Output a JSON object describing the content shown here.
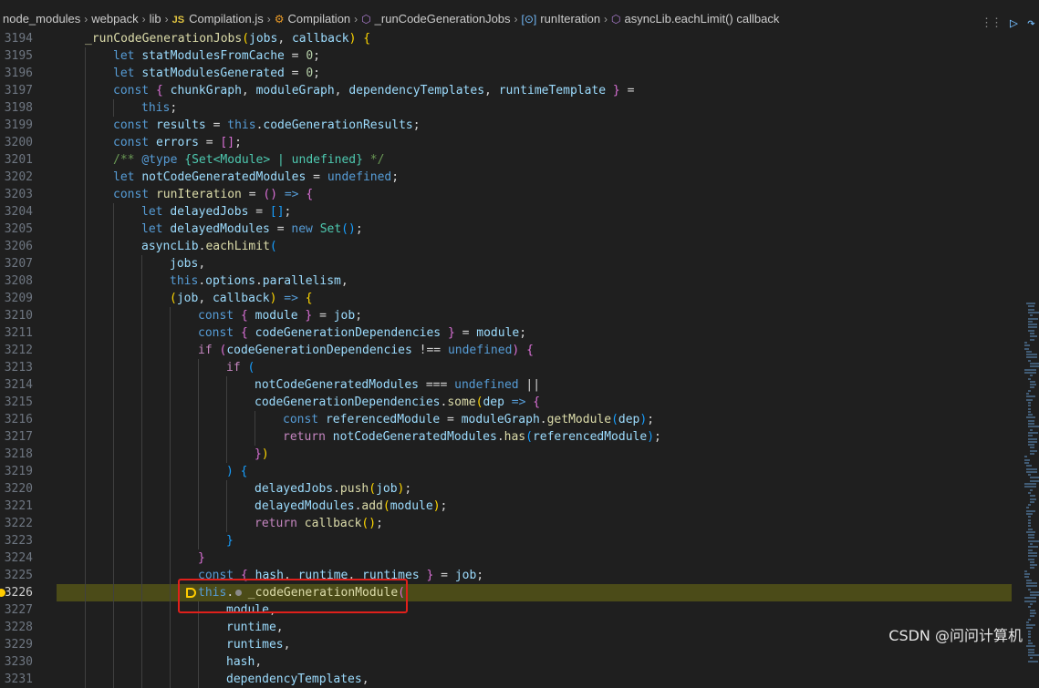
{
  "breadcrumb": {
    "items": [
      "node_modules",
      "webpack",
      "lib",
      "Compilation.js",
      "Compilation",
      "_runCodeGenerationJobs",
      "runIteration",
      "asyncLib.eachLimit() callback"
    ],
    "js_badge": "JS"
  },
  "editor": {
    "first_line": 3194,
    "current_line": 3226,
    "lines": [
      {
        "n": "3194",
        "indent": 1,
        "tokens": [
          [
            "f",
            "_runCodeGenerationJobs"
          ],
          [
            "b1",
            "("
          ],
          [
            "v",
            "jobs"
          ],
          [
            "p",
            ", "
          ],
          [
            "v",
            "callback"
          ],
          [
            "b1",
            ")"
          ],
          [
            "p",
            " "
          ],
          [
            "b1",
            "{"
          ]
        ]
      },
      {
        "n": "3195",
        "indent": 2,
        "tokens": [
          [
            "k",
            "let "
          ],
          [
            "v",
            "statModulesFromCache"
          ],
          [
            "p",
            " = "
          ],
          [
            "n",
            "0"
          ],
          [
            "p",
            ";"
          ]
        ]
      },
      {
        "n": "3196",
        "indent": 2,
        "tokens": [
          [
            "k",
            "let "
          ],
          [
            "v",
            "statModulesGenerated"
          ],
          [
            "p",
            " = "
          ],
          [
            "n",
            "0"
          ],
          [
            "p",
            ";"
          ]
        ]
      },
      {
        "n": "3197",
        "indent": 2,
        "tokens": [
          [
            "k",
            "const "
          ],
          [
            "b2",
            "{ "
          ],
          [
            "v",
            "chunkGraph"
          ],
          [
            "p",
            ", "
          ],
          [
            "v",
            "moduleGraph"
          ],
          [
            "p",
            ", "
          ],
          [
            "v",
            "dependencyTemplates"
          ],
          [
            "p",
            ", "
          ],
          [
            "v",
            "runtimeTemplate"
          ],
          [
            "b2",
            " }"
          ],
          [
            "p",
            " ="
          ]
        ]
      },
      {
        "n": "3198",
        "indent": 3,
        "tokens": [
          [
            "k",
            "this"
          ],
          [
            "p",
            ";"
          ]
        ]
      },
      {
        "n": "3199",
        "indent": 2,
        "tokens": [
          [
            "k",
            "const "
          ],
          [
            "v",
            "results"
          ],
          [
            "p",
            " = "
          ],
          [
            "k",
            "this"
          ],
          [
            "p",
            "."
          ],
          [
            "v",
            "codeGenerationResults"
          ],
          [
            "p",
            ";"
          ]
        ]
      },
      {
        "n": "3200",
        "indent": 2,
        "tokens": [
          [
            "k",
            "const "
          ],
          [
            "v",
            "errors"
          ],
          [
            "p",
            " = "
          ],
          [
            "b2",
            "[]"
          ],
          [
            "p",
            ";"
          ]
        ]
      },
      {
        "n": "3201",
        "indent": 2,
        "tokens": [
          [
            "c",
            "/** "
          ],
          [
            "k",
            "@type"
          ],
          [
            "c",
            " "
          ],
          [
            "t",
            "{Set<Module> | undefined}"
          ],
          [
            "c",
            " */"
          ]
        ]
      },
      {
        "n": "3202",
        "indent": 2,
        "tokens": [
          [
            "k",
            "let "
          ],
          [
            "v",
            "notCodeGeneratedModules"
          ],
          [
            "p",
            " = "
          ],
          [
            "k",
            "undefined"
          ],
          [
            "p",
            ";"
          ]
        ]
      },
      {
        "n": "3203",
        "indent": 2,
        "tokens": [
          [
            "k",
            "const "
          ],
          [
            "f",
            "runIteration"
          ],
          [
            "p",
            " = "
          ],
          [
            "b2",
            "()"
          ],
          [
            "p",
            " "
          ],
          [
            "k",
            "=>"
          ],
          [
            "p",
            " "
          ],
          [
            "b2",
            "{"
          ]
        ]
      },
      {
        "n": "3204",
        "indent": 3,
        "tokens": [
          [
            "k",
            "let "
          ],
          [
            "v",
            "delayedJobs"
          ],
          [
            "p",
            " = "
          ],
          [
            "b3",
            "[]"
          ],
          [
            "p",
            ";"
          ]
        ]
      },
      {
        "n": "3205",
        "indent": 3,
        "tokens": [
          [
            "k",
            "let "
          ],
          [
            "v",
            "delayedModules"
          ],
          [
            "p",
            " = "
          ],
          [
            "k",
            "new "
          ],
          [
            "t",
            "Set"
          ],
          [
            "b3",
            "()"
          ],
          [
            "p",
            ";"
          ]
        ]
      },
      {
        "n": "3206",
        "indent": 3,
        "tokens": [
          [
            "v",
            "asyncLib"
          ],
          [
            "p",
            "."
          ],
          [
            "f",
            "eachLimit"
          ],
          [
            "b3",
            "("
          ]
        ]
      },
      {
        "n": "3207",
        "indent": 4,
        "tokens": [
          [
            "v",
            "jobs"
          ],
          [
            "p",
            ","
          ]
        ]
      },
      {
        "n": "3208",
        "indent": 4,
        "tokens": [
          [
            "k",
            "this"
          ],
          [
            "p",
            "."
          ],
          [
            "v",
            "options"
          ],
          [
            "p",
            "."
          ],
          [
            "v",
            "parallelism"
          ],
          [
            "p",
            ","
          ]
        ]
      },
      {
        "n": "3209",
        "indent": 4,
        "tokens": [
          [
            "b1",
            "("
          ],
          [
            "v",
            "job"
          ],
          [
            "p",
            ", "
          ],
          [
            "v",
            "callback"
          ],
          [
            "b1",
            ")"
          ],
          [
            "p",
            " "
          ],
          [
            "k",
            "=>"
          ],
          [
            "p",
            " "
          ],
          [
            "b1",
            "{"
          ]
        ]
      },
      {
        "n": "3210",
        "indent": 5,
        "tokens": [
          [
            "k",
            "const "
          ],
          [
            "b2",
            "{ "
          ],
          [
            "v",
            "module"
          ],
          [
            "b2",
            " }"
          ],
          [
            "p",
            " = "
          ],
          [
            "v",
            "job"
          ],
          [
            "p",
            ";"
          ]
        ]
      },
      {
        "n": "3211",
        "indent": 5,
        "tokens": [
          [
            "k",
            "const "
          ],
          [
            "b2",
            "{ "
          ],
          [
            "v",
            "codeGenerationDependencies"
          ],
          [
            "b2",
            " }"
          ],
          [
            "p",
            " = "
          ],
          [
            "v",
            "module"
          ],
          [
            "p",
            ";"
          ]
        ]
      },
      {
        "n": "3212",
        "indent": 5,
        "tokens": [
          [
            "kc",
            "if "
          ],
          [
            "b2",
            "("
          ],
          [
            "v",
            "codeGenerationDependencies"
          ],
          [
            "p",
            " !== "
          ],
          [
            "k",
            "undefined"
          ],
          [
            "b2",
            ")"
          ],
          [
            "p",
            " "
          ],
          [
            "b2",
            "{"
          ]
        ]
      },
      {
        "n": "3213",
        "indent": 6,
        "tokens": [
          [
            "kc",
            "if "
          ],
          [
            "b3",
            "("
          ]
        ]
      },
      {
        "n": "3214",
        "indent": 7,
        "tokens": [
          [
            "v",
            "notCodeGeneratedModules"
          ],
          [
            "p",
            " === "
          ],
          [
            "k",
            "undefined"
          ],
          [
            "p",
            " ||"
          ]
        ]
      },
      {
        "n": "3215",
        "indent": 7,
        "tokens": [
          [
            "v",
            "codeGenerationDependencies"
          ],
          [
            "p",
            "."
          ],
          [
            "f",
            "some"
          ],
          [
            "b1",
            "("
          ],
          [
            "v",
            "dep"
          ],
          [
            "p",
            " "
          ],
          [
            "k",
            "=>"
          ],
          [
            "p",
            " "
          ],
          [
            "b2",
            "{"
          ]
        ]
      },
      {
        "n": "3216",
        "indent": 8,
        "tokens": [
          [
            "k",
            "const "
          ],
          [
            "v",
            "referencedModule"
          ],
          [
            "p",
            " = "
          ],
          [
            "v",
            "moduleGraph"
          ],
          [
            "p",
            "."
          ],
          [
            "f",
            "getModule"
          ],
          [
            "b3",
            "("
          ],
          [
            "v",
            "dep"
          ],
          [
            "b3",
            ")"
          ],
          [
            "p",
            ";"
          ]
        ]
      },
      {
        "n": "3217",
        "indent": 8,
        "tokens": [
          [
            "kc",
            "return "
          ],
          [
            "v",
            "notCodeGeneratedModules"
          ],
          [
            "p",
            "."
          ],
          [
            "f",
            "has"
          ],
          [
            "b3",
            "("
          ],
          [
            "v",
            "referencedModule"
          ],
          [
            "b3",
            ")"
          ],
          [
            "p",
            ";"
          ]
        ]
      },
      {
        "n": "3218",
        "indent": 7,
        "tokens": [
          [
            "b2",
            "}"
          ],
          [
            "b1",
            ")"
          ]
        ]
      },
      {
        "n": "3219",
        "indent": 6,
        "tokens": [
          [
            "b3",
            ")"
          ],
          [
            "p",
            " "
          ],
          [
            "b3",
            "{"
          ]
        ]
      },
      {
        "n": "3220",
        "indent": 7,
        "tokens": [
          [
            "v",
            "delayedJobs"
          ],
          [
            "p",
            "."
          ],
          [
            "f",
            "push"
          ],
          [
            "b1",
            "("
          ],
          [
            "v",
            "job"
          ],
          [
            "b1",
            ")"
          ],
          [
            "p",
            ";"
          ]
        ]
      },
      {
        "n": "3221",
        "indent": 7,
        "tokens": [
          [
            "v",
            "delayedModules"
          ],
          [
            "p",
            "."
          ],
          [
            "f",
            "add"
          ],
          [
            "b1",
            "("
          ],
          [
            "v",
            "module"
          ],
          [
            "b1",
            ")"
          ],
          [
            "p",
            ";"
          ]
        ]
      },
      {
        "n": "3222",
        "indent": 7,
        "tokens": [
          [
            "kc",
            "return "
          ],
          [
            "f",
            "callback"
          ],
          [
            "b1",
            "()"
          ],
          [
            "p",
            ";"
          ]
        ]
      },
      {
        "n": "3223",
        "indent": 6,
        "tokens": [
          [
            "b3",
            "}"
          ]
        ]
      },
      {
        "n": "3224",
        "indent": 5,
        "tokens": [
          [
            "b2",
            "}"
          ]
        ]
      },
      {
        "n": "3225",
        "indent": 5,
        "tokens": [
          [
            "k",
            "const "
          ],
          [
            "b2",
            "{ "
          ],
          [
            "v",
            "hash"
          ],
          [
            "p",
            ", "
          ],
          [
            "v",
            "runtime"
          ],
          [
            "p",
            ", "
          ],
          [
            "v",
            "runtimes"
          ],
          [
            "b2",
            " }"
          ],
          [
            "p",
            " = "
          ],
          [
            "v",
            "job"
          ],
          [
            "p",
            ";"
          ]
        ]
      },
      {
        "n": "3226",
        "indent": 5,
        "tokens": [
          [
            "k",
            "this"
          ],
          [
            "p",
            ".  "
          ],
          [
            "f",
            "_codeGenerationModule"
          ],
          [
            "b2",
            "("
          ]
        ]
      },
      {
        "n": "3227",
        "indent": 6,
        "tokens": [
          [
            "v",
            "module"
          ],
          [
            "p",
            ","
          ]
        ]
      },
      {
        "n": "3228",
        "indent": 6,
        "tokens": [
          [
            "v",
            "runtime"
          ],
          [
            "p",
            ","
          ]
        ]
      },
      {
        "n": "3229",
        "indent": 6,
        "tokens": [
          [
            "v",
            "runtimes"
          ],
          [
            "p",
            ","
          ]
        ]
      },
      {
        "n": "3230",
        "indent": 6,
        "tokens": [
          [
            "v",
            "hash"
          ],
          [
            "p",
            ","
          ]
        ]
      },
      {
        "n": "3231",
        "indent": 6,
        "tokens": [
          [
            "v",
            "dependencyTemplates"
          ],
          [
            "p",
            ","
          ]
        ]
      }
    ]
  },
  "watermark": "CSDN @问问计算机",
  "colors": {
    "background": "#1f1f1f",
    "current_line_highlight": "#4b4b18",
    "focus_box": "#e0201b",
    "breakpoint": "#ffcc00"
  }
}
